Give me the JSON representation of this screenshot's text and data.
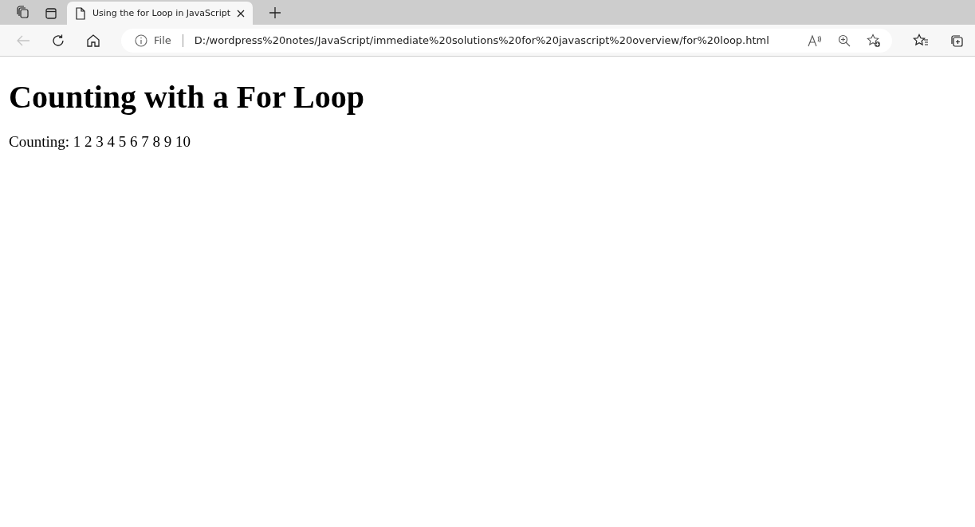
{
  "tabs": [
    {
      "title": "Using the for Loop in JavaScript",
      "selected": true
    }
  ],
  "toolbar": {
    "back_disabled": true
  },
  "address_bar": {
    "scheme_label": "File",
    "url": "D:/wordpress%20notes/JavaScript/immediate%20solutions%20for%20javascript%20overview/for%20loop.html"
  },
  "page": {
    "heading": "Counting with a For Loop",
    "text": "Counting: 1 2 3 4 5 6 7 8 9 10"
  }
}
